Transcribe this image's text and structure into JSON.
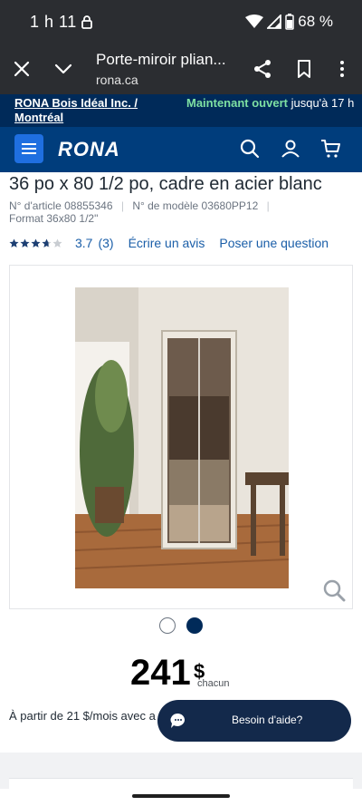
{
  "status_bar": {
    "time": "1 h 11",
    "battery": "68 %"
  },
  "browser": {
    "page_title": "Porte-miroir plian...",
    "url": "rona.ca"
  },
  "store": {
    "name": "RONA Bois Idéal Inc. / Montréal",
    "open_label": "Maintenant ouvert",
    "hours": "jusqu'à 17 h"
  },
  "header": {
    "logo": "RONA"
  },
  "product": {
    "title_visible": "36 po x 80 1/2 po, cadre en acier blanc",
    "article_label": "N° d'article",
    "article_number": "08855346",
    "model_label": "N° de modèle",
    "model_number": "03680PP12",
    "format_label": "Format",
    "format_value": "36x80 1/2\"",
    "rating_stars": 3.7,
    "rating_value": "3.7",
    "rating_count": "(3)",
    "write_review": "Écrire un avis",
    "ask_question": "Poser une question",
    "price": "241",
    "currency": "$",
    "price_unit": "chacun",
    "financing": "À partir de 21 $/mois avec a"
  },
  "carousel": {
    "total": 2,
    "active": 2
  },
  "help": {
    "label": "Besoin d'aide?"
  },
  "colors": {
    "brand_dark": "#002a59",
    "header_blue": "#003d7c",
    "link_blue": "#1a5ea8",
    "open_green": "#7ee0a3"
  }
}
